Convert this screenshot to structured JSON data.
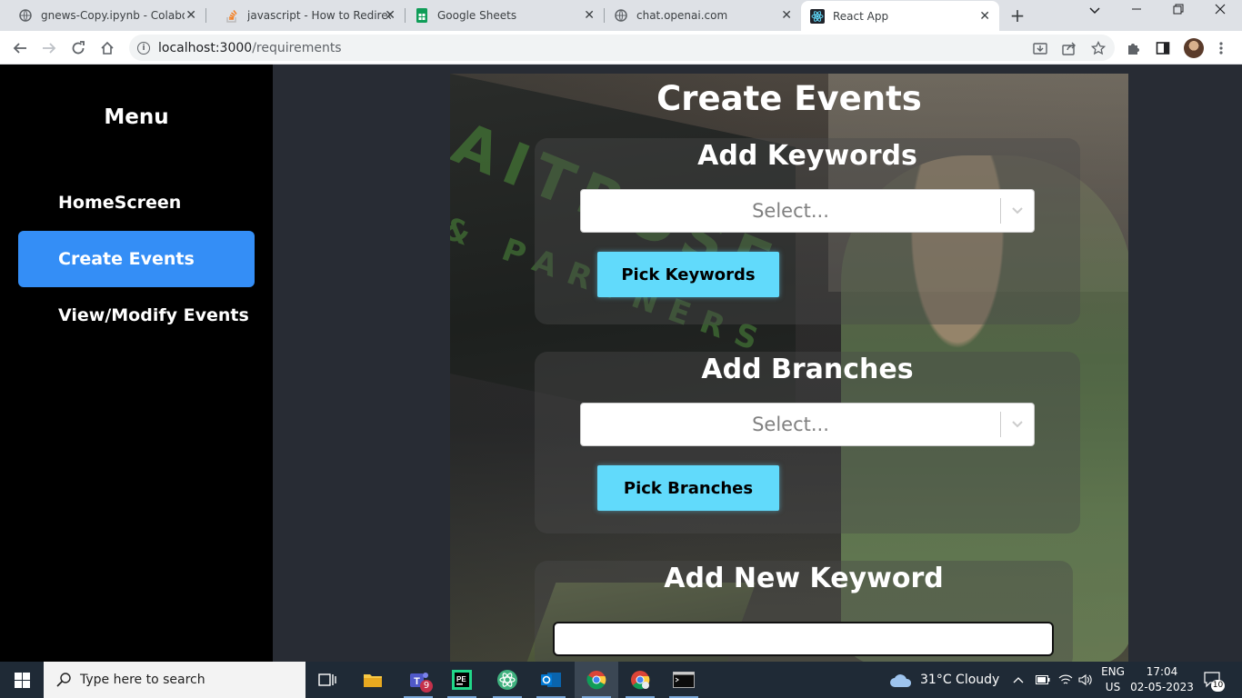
{
  "browser": {
    "tabs": [
      {
        "title": "gnews-Copy.ipynb - Colaboratory",
        "icon": "globe-icon"
      },
      {
        "title": "javascript - How to Redirect to",
        "icon": "stackoverflow-icon"
      },
      {
        "title": "Google Sheets",
        "icon": "sheets-icon"
      },
      {
        "title": "chat.openai.com",
        "icon": "globe-icon"
      },
      {
        "title": "React App",
        "icon": "react-icon"
      }
    ],
    "url_host": "localhost:3000",
    "url_path": "/requirements"
  },
  "sidebar": {
    "title": "Menu",
    "items": [
      {
        "label": "HomeScreen"
      },
      {
        "label": "Create Events"
      },
      {
        "label": "View/Modify Events"
      }
    ]
  },
  "main": {
    "title": "Create Events",
    "keywords": {
      "title": "Add Keywords",
      "placeholder": "Select...",
      "button": "Pick Keywords"
    },
    "branches": {
      "title": "Add Branches",
      "placeholder": "Select...",
      "button": "Pick Branches"
    },
    "new_keyword": {
      "title": "Add New Keyword",
      "value": ""
    }
  },
  "hero_text": {
    "brand": "AITROSE",
    "brand_sub": "& PARTNERS"
  },
  "taskbar": {
    "search_placeholder": "Type here to search",
    "teams_badge": "9",
    "weather": "31°C  Cloudy",
    "lang_top": "ENG",
    "lang_bottom": "US",
    "time": "17:04",
    "date": "02-05-2023",
    "notifications": "10"
  },
  "colors": {
    "accent": "#348ef6",
    "button": "#61dafb",
    "sidebar": "#000000",
    "main_bg": "#282c34"
  }
}
